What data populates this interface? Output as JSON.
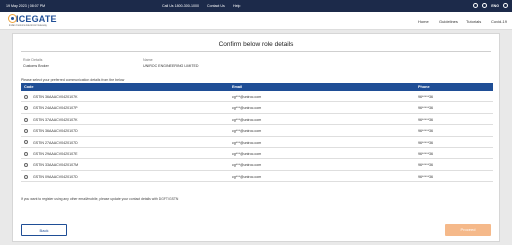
{
  "topbar": {
    "datetime": "19 May 2023 | 08:07 PM",
    "call_us": "Call Us 1800-300-1000",
    "contact_us": "Contact Us",
    "help": "Help",
    "language": "ENG"
  },
  "brand": {
    "name": "ICEGATE",
    "tagline": "Indian Customs Electronic Gateway"
  },
  "nav": {
    "items": [
      "Home",
      "Guidelines",
      "Tutorials",
      "Covid-19"
    ]
  },
  "page": {
    "title": "Confirm below role details",
    "role_label": "Role Details",
    "role_value": "Customs Broker",
    "name_label": "Name",
    "name_value": "UNIROC ENGINEERING LIMITED",
    "instruction": "Please select your preferred communication details from the below",
    "note": "If you want to register using any other email/mobile, please update your contact details with DGFT/GSTN"
  },
  "table": {
    "headers": {
      "code": "Code",
      "email": "Email",
      "phone": "Phone"
    },
    "rows": [
      {
        "code": "GSTIN 36AAACV0420107K",
        "email": "cg***@uniroc.com",
        "phone": "96*****36"
      },
      {
        "code": "GSTIN 24AAACV0420107P",
        "email": "cg***@uniroc.com",
        "phone": "96*****36"
      },
      {
        "code": "GSTIN 37AAACV0420107K",
        "email": "cg***@uniroc.com",
        "phone": "96*****36"
      },
      {
        "code": "GSTIN 36AAACV0420107D",
        "email": "cg***@uniroc.com",
        "phone": "96*****36"
      },
      {
        "code": "GSTIN 27AAACV0420107D",
        "email": "cg***@uniroc.com",
        "phone": "96*****36"
      },
      {
        "code": "GSTIN 29AAACV0420107E",
        "email": "cg***@uniroc.com",
        "phone": "96*****36"
      },
      {
        "code": "GSTIN 33AAACV0420107M",
        "email": "cg***@uniroc.com",
        "phone": "96*****36"
      },
      {
        "code": "GSTIN 09AAACV0420107D",
        "email": "cg***@uniroc.com",
        "phone": "96*****36"
      }
    ]
  },
  "buttons": {
    "back": "Back",
    "proceed": "Proceed"
  },
  "colors": {
    "topbar": "#1c2a4a",
    "accent": "#1f4e96",
    "brand_orange": "#f0a43c",
    "proceed_disabled": "#f5b98a"
  }
}
